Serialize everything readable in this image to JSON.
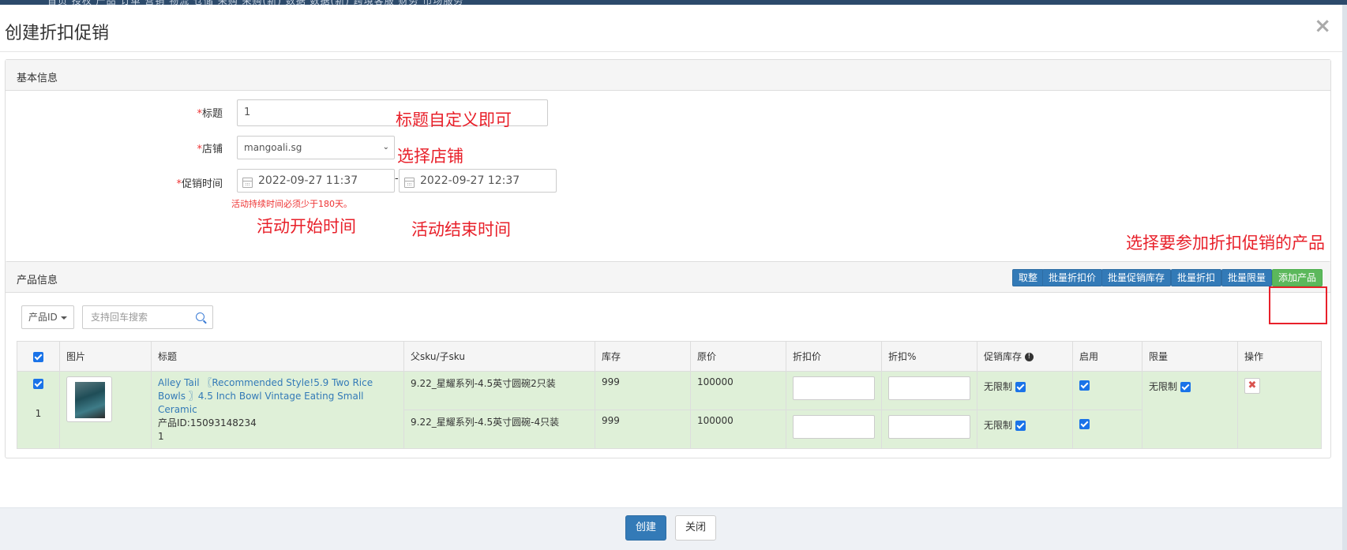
{
  "background": {
    "nav_text": "首页    授权    产品    订单    营销    物流    仓储    采购    采购(新)    数据    数据(新)    跨境客服    财务    市场服务"
  },
  "modal": {
    "title": "创建折扣促销",
    "close_symbol": "×"
  },
  "basic_info": {
    "heading": "基本信息",
    "title_label": "标题",
    "title_value": "1",
    "shop_label": "店铺",
    "shop_value": "mangoali.sg",
    "time_label": "促销时间",
    "required_mark": "*",
    "start_time": "2022-09-27 11:37",
    "end_time": "2022-09-27 12:37",
    "time_separator": "-",
    "time_hint": "活动持续时间必须少于180天。"
  },
  "annotations": {
    "title_note": "标题自定义即可",
    "shop_note": "选择店铺",
    "start_note": "活动开始时间",
    "end_note": "活动结束时间",
    "product_note": "选择要参加折扣促销的产品"
  },
  "product_info": {
    "heading": "产品信息",
    "buttons": {
      "round": "取整",
      "batch_price": "批量折扣价",
      "batch_stock": "批量促销库存",
      "batch_discount": "批量折扣",
      "batch_limit": "批量限量",
      "add_product": "添加产品"
    },
    "filter_label": "产品ID",
    "search_placeholder": "支持回车搜索",
    "columns": [
      "图片",
      "标题",
      "父sku/子sku",
      "库存",
      "原价",
      "折扣价",
      "折扣%",
      "促销库存",
      "启用",
      "限量",
      "操作"
    ],
    "row": {
      "index": "1",
      "title": "Alley Tail 〖Recommended Style!5.9 Two Rice Bowls 〗4.5 Inch Bowl Vintage Eating Small Ceramic",
      "product_id": "产品ID:15093148234",
      "extra": "1",
      "unlimited": "无限制",
      "variants": [
        {
          "sku": "9.22_星耀系列-4.5英寸圆碗2只装",
          "stock": "999",
          "price": "100000"
        },
        {
          "sku": "9.22_星耀系列-4.5英寸圆碗-4只装",
          "stock": "999",
          "price": "100000"
        }
      ]
    }
  },
  "footer": {
    "create": "创建",
    "close": "关闭"
  }
}
